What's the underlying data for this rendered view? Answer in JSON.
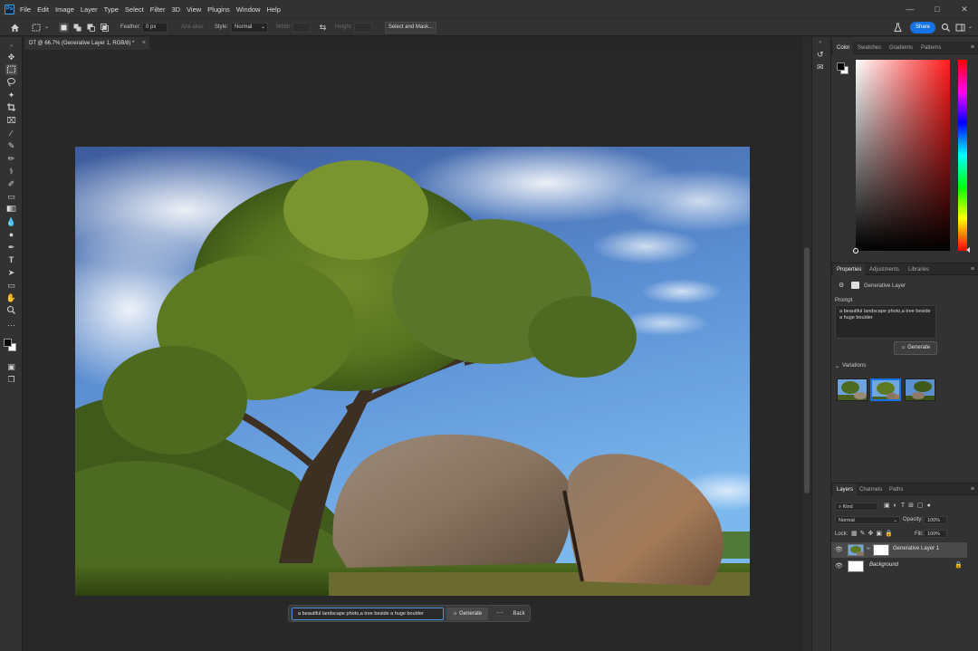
{
  "app": {
    "logo": "Ps"
  },
  "menu": [
    "File",
    "Edit",
    "Image",
    "Layer",
    "Type",
    "Select",
    "Filter",
    "3D",
    "View",
    "Plugins",
    "Window",
    "Help"
  ],
  "options": {
    "feather_label": "Feather:",
    "feather_value": "0 px",
    "antialias_label": "Anti-alias",
    "style_label": "Style:",
    "style_value": "Normal",
    "width_label": "Width:",
    "height_label": "Height:",
    "select_mask": "Select and Mask...",
    "share": "Share"
  },
  "document": {
    "tab_title": "DT @ 66.7% (Generative Layer 1, RGB/8) *",
    "close": "×"
  },
  "taskbar": {
    "prompt": "a beautiful landscape photo,a tree beside a huge boulder",
    "generate": "Generate",
    "more": "···",
    "back": "Back"
  },
  "color_panel": {
    "tabs": [
      "Color",
      "Swatches",
      "Gradients",
      "Patterns"
    ],
    "foreground": "#000000",
    "background": "#ffffff",
    "hue": "#ff1a1a"
  },
  "properties_panel": {
    "tabs": [
      "Properties",
      "Adjustments",
      "Libraries"
    ],
    "layer_type": "Generative Layer",
    "prompt_label": "Prompt",
    "prompt_text": "a beautiful landscape photo,a tree beside a huge boulder",
    "generate": "Generate",
    "variations_label": "Variations"
  },
  "layers_panel": {
    "tabs": [
      "Layers",
      "Channels",
      "Paths"
    ],
    "kind": "Kind",
    "blend_mode": "Normal",
    "opacity_label": "Opacity:",
    "opacity_value": "100%",
    "lock_label": "Lock:",
    "fill_label": "Fill:",
    "fill_value": "100%",
    "layers": [
      {
        "name": "Generative Layer 1",
        "selected": true
      },
      {
        "name": "Background",
        "selected": false
      }
    ]
  },
  "icons": {
    "menu": "hamburger-icon",
    "close": "close-icon",
    "more": "more-icon"
  }
}
